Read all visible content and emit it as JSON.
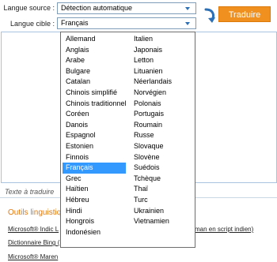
{
  "header": {
    "source_label": "Langue source :",
    "source_value": "Détection automatique",
    "target_label": "Langue cible :",
    "target_value": "Français",
    "translate_label": "Traduire"
  },
  "dropdown": {
    "selected": "Français",
    "col_left": [
      "Allemand",
      "Anglais",
      "Arabe",
      "Bulgare",
      "Catalan",
      "Chinois simplifié",
      "Chinois traditionnel",
      "Coréen",
      "Danois",
      "Espagnol",
      "Estonien",
      "Finnois",
      "Français",
      "Grec",
      "Haïtien",
      "Hébreu",
      "Hindi",
      "Hongrois",
      "Indonésien"
    ],
    "col_right": [
      "Italien",
      "Japonais",
      "Letton",
      "Lituanien",
      "Néerlandais",
      "Norvégien",
      "Polonais",
      "Portugais",
      "Roumain",
      "Russe",
      "Slovaque",
      "Slovène",
      "Suédois",
      "Tchèque",
      "Thaï",
      "Turc",
      "Ukrainien",
      "Vietnamien"
    ]
  },
  "target_placeholder": "Texte à traduire",
  "tools": {
    "title": "Outils linguistiqu",
    "links": [
      "Microsoft® Indic L",
      "Dictionnaire Bing (",
      "Microsoft® Maren"
    ],
    "link_suffix": "man en script indien)"
  },
  "colors": {
    "accent": "#f0901e",
    "selection": "#3399ff",
    "link_blue": "#2b6fb6"
  }
}
